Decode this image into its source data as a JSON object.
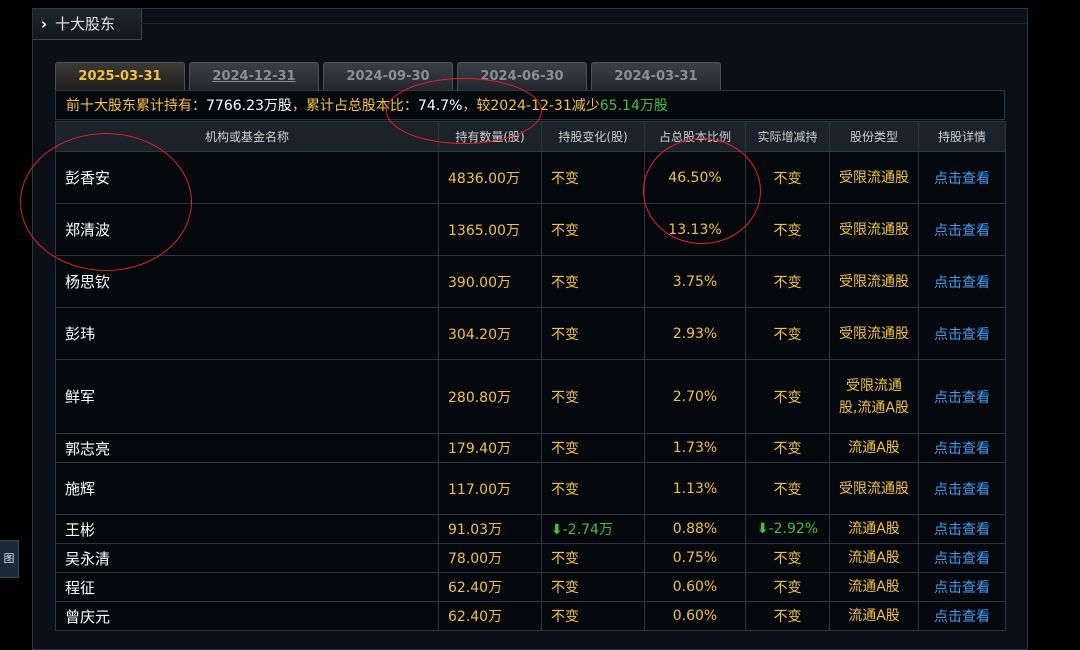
{
  "side_stub": "图",
  "panel": {
    "title": "十大股东"
  },
  "tabs": [
    {
      "label": "2025-03-31",
      "active": true
    },
    {
      "label": "2024-12-31",
      "active": false
    },
    {
      "label": "2024-09-30",
      "active": false
    },
    {
      "label": "2024-06-30",
      "active": false
    },
    {
      "label": "2024-03-31",
      "active": false
    }
  ],
  "summary": {
    "prefix": "前十大股东累计持有：",
    "total": "7766.23万股",
    "ratio_label": "，累计占总股本比：",
    "ratio": "74.7%",
    "compare": "，较2024-12-31减少",
    "change": "65.14万股"
  },
  "table": {
    "headers": [
      "机构或基金名称",
      "持有数量(股)",
      "持股变化(股)",
      "占总股本比例",
      "实际增减持",
      "股份类型",
      "持股详情"
    ],
    "rows": [
      {
        "name": "彭香安",
        "qty": "4836.00万",
        "change": "不变",
        "ratio": "46.50%",
        "actual": "不变",
        "type": "受限流通股",
        "detail": "点击查看"
      },
      {
        "name": "郑清波",
        "qty": "1365.00万",
        "change": "不变",
        "ratio": "13.13%",
        "actual": "不变",
        "type": "受限流通股",
        "detail": "点击查看"
      },
      {
        "name": "杨思钦",
        "qty": "390.00万",
        "change": "不变",
        "ratio": "3.75%",
        "actual": "不变",
        "type": "受限流通股",
        "detail": "点击查看"
      },
      {
        "name": "彭玮",
        "qty": "304.20万",
        "change": "不变",
        "ratio": "2.93%",
        "actual": "不变",
        "type": "受限流通股",
        "detail": "点击查看"
      },
      {
        "name": "鲜军",
        "qty": "280.80万",
        "change": "不变",
        "ratio": "2.70%",
        "actual": "不变",
        "type": "受限流通股,流通A股",
        "detail": "点击查看"
      },
      {
        "name": "郭志亮",
        "qty": "179.40万",
        "change": "不变",
        "ratio": "1.73%",
        "actual": "不变",
        "type": "流通A股",
        "detail": "点击查看"
      },
      {
        "name": "施辉",
        "qty": "117.00万",
        "change": "不变",
        "ratio": "1.13%",
        "actual": "不变",
        "type": "受限流通股",
        "detail": "点击查看"
      },
      {
        "name": "王彬",
        "qty": "91.03万",
        "change": "-2.74万",
        "ratio": "0.88%",
        "actual": "-2.92%",
        "type": "流通A股",
        "detail": "点击查看",
        "down": true
      },
      {
        "name": "吴永清",
        "qty": "78.00万",
        "change": "不变",
        "ratio": "0.75%",
        "actual": "不变",
        "type": "流通A股",
        "detail": "点击查看"
      },
      {
        "name": "程征",
        "qty": "62.40万",
        "change": "不变",
        "ratio": "0.60%",
        "actual": "不变",
        "type": "流通A股",
        "detail": "点击查看"
      },
      {
        "name": "曾庆元",
        "qty": "62.40万",
        "change": "不变",
        "ratio": "0.60%",
        "actual": "不变",
        "type": "流通A股",
        "detail": "点击查看"
      }
    ]
  },
  "annotation_color": "#e0202a"
}
